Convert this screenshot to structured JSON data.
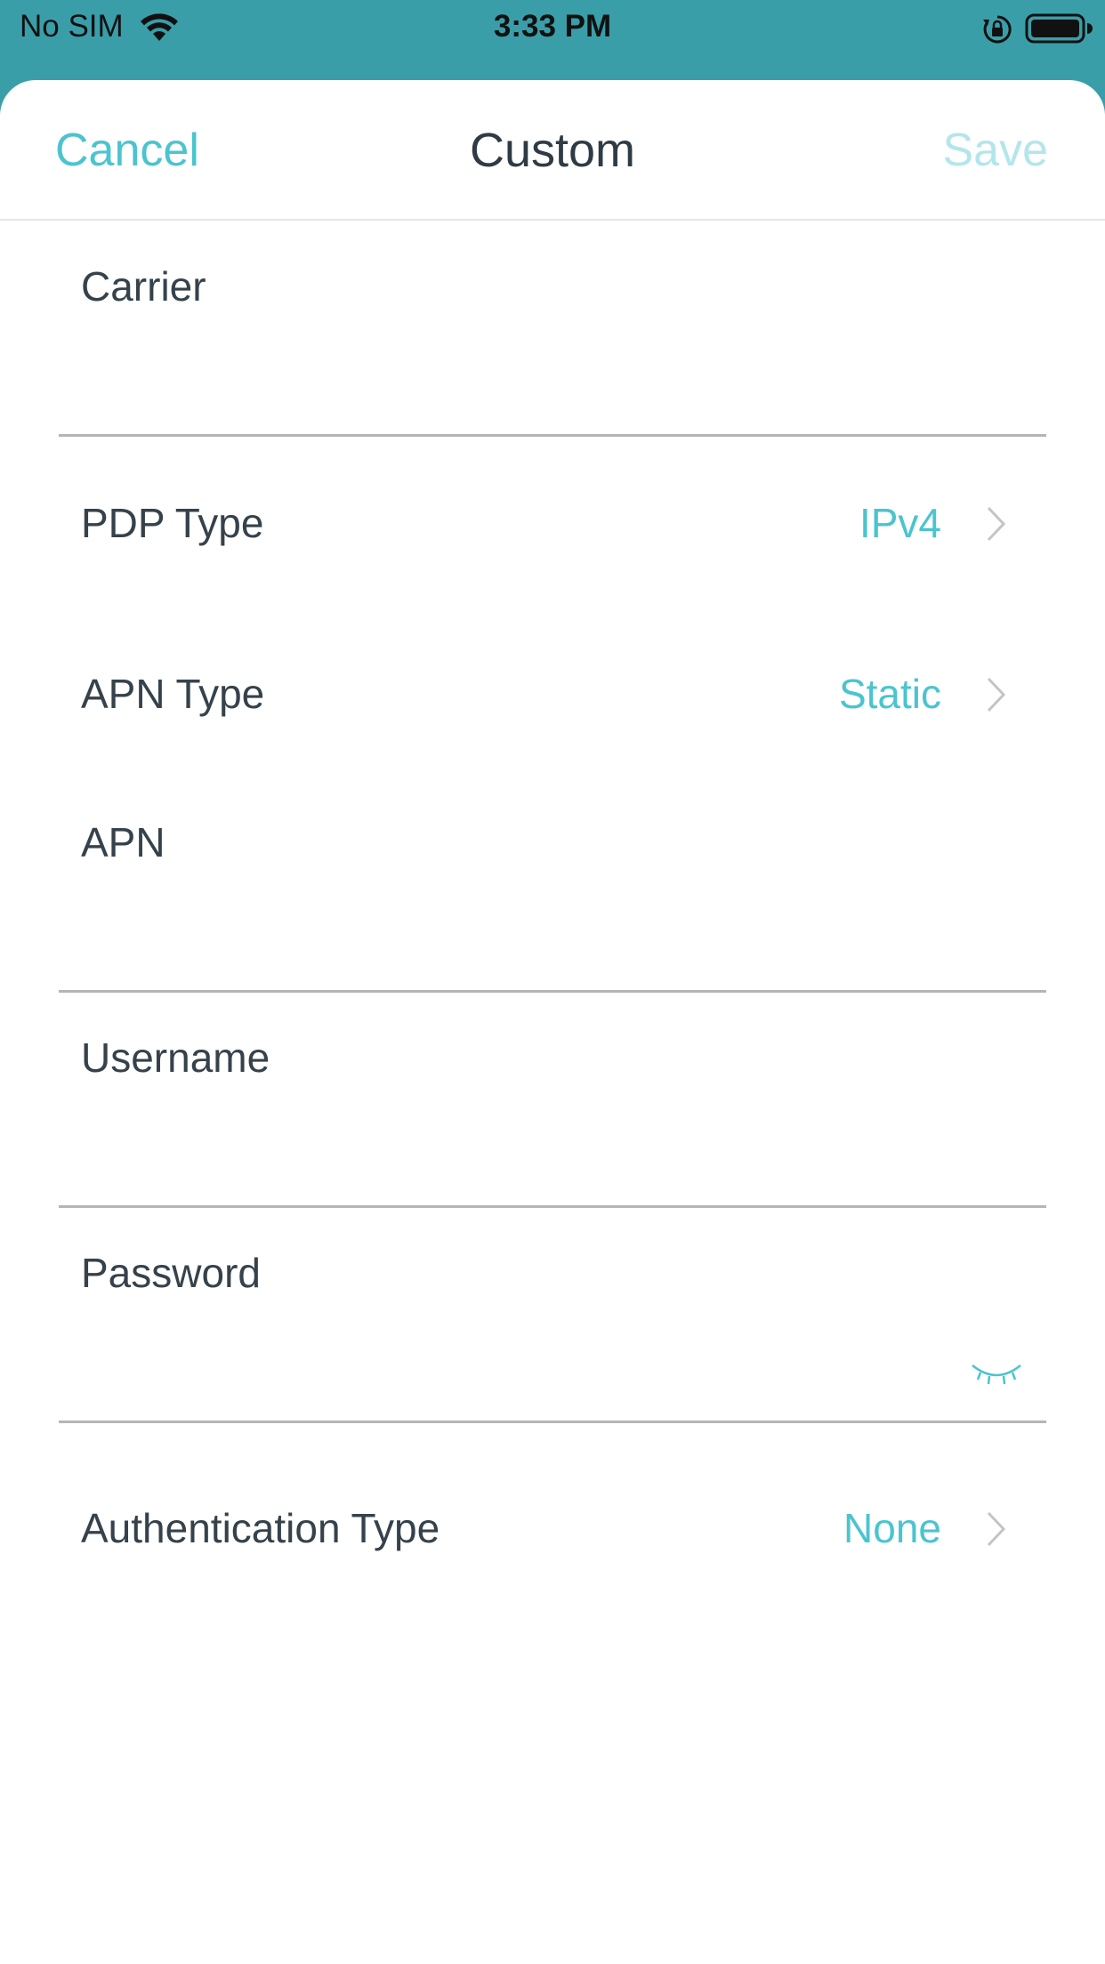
{
  "status_bar": {
    "carrier": "No SIM",
    "time": "3:33 PM",
    "icons": [
      "wifi-icon",
      "lock-rotation-icon",
      "battery-icon"
    ]
  },
  "nav": {
    "cancel_label": "Cancel",
    "title": "Custom",
    "save_label": "Save"
  },
  "form": {
    "carrier": {
      "label": "Carrier",
      "value": ""
    },
    "pdp_type": {
      "label": "PDP Type",
      "value": "IPv4"
    },
    "apn_type": {
      "label": "APN Type",
      "value": "Static"
    },
    "apn": {
      "label": "APN",
      "value": ""
    },
    "username": {
      "label": "Username",
      "value": ""
    },
    "password": {
      "label": "Password",
      "value": ""
    },
    "authentication_type": {
      "label": "Authentication Type",
      "value": "None"
    }
  },
  "colors": {
    "accent": "#4bc4cf",
    "accent_disabled": "#b3e6eb",
    "status_bar_bg": "#3a9ea9",
    "label_text": "#36424b",
    "title_text": "#2f3b44",
    "divider": "#b5b5b5"
  }
}
